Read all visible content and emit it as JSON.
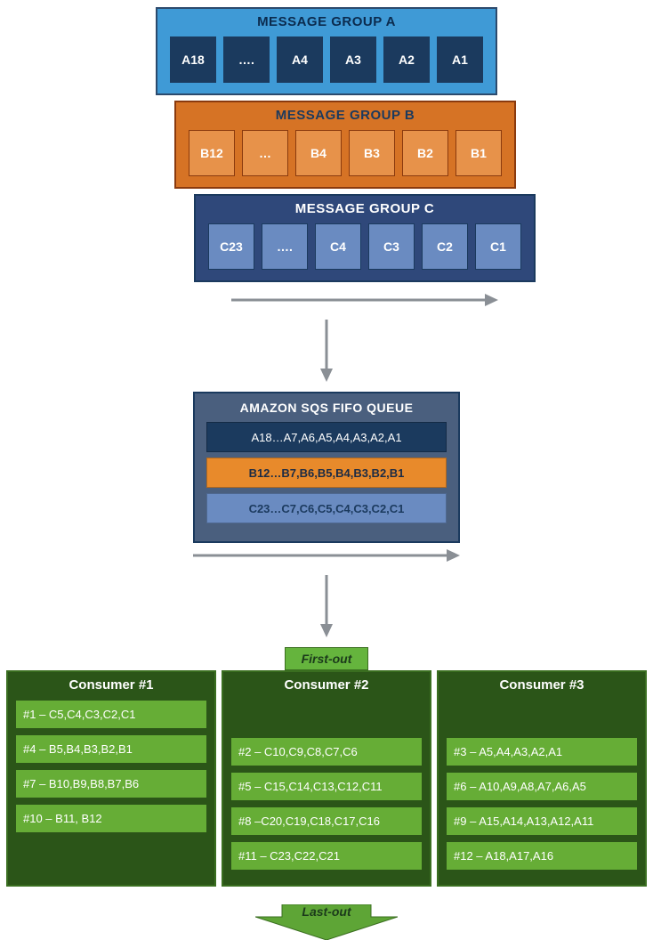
{
  "groupA": {
    "title": "MESSAGE GROUP A",
    "cells": [
      "A18",
      "….",
      "A4",
      "A3",
      "A2",
      "A1"
    ]
  },
  "groupB": {
    "title": "MESSAGE GROUP B",
    "cells": [
      "B12",
      "…",
      "B4",
      "B3",
      "B2",
      "B1"
    ]
  },
  "groupC": {
    "title": "MESSAGE GROUP C",
    "cells": [
      "C23",
      "….",
      "C4",
      "C3",
      "C2",
      "C1"
    ]
  },
  "queue": {
    "title": "AMAZON SQS FIFO QUEUE",
    "rowA": "A18…A7,A6,A5,A4,A3,A2,A1",
    "rowB": "B12…B7,B6,B5,B4,B3,B2,B1",
    "rowC": "C23…C7,C6,C5,C4,C3,C2,C1"
  },
  "labels": {
    "first_out": "First-out",
    "last_out": "Last-out"
  },
  "consumers": [
    {
      "title": "Consumer #1",
      "batches": [
        "#1 – C5,C4,C3,C2,C1",
        "#4 – B5,B4,B3,B2,B1",
        "#7 – B10,B9,B8,B7,B6",
        "#10 – B11, B12"
      ]
    },
    {
      "title": "Consumer #2",
      "batches": [
        "#2 – C10,C9,C8,C7,C6",
        "#5 – C15,C14,C13,C12,C11",
        "#8 –C20,C19,C18,C17,C16",
        "#11 – C23,C22,C21"
      ]
    },
    {
      "title": "Consumer #3",
      "batches": [
        "#3 – A5,A4,A3,A2,A1",
        "#6 – A10,A9,A8,A7,A6,A5",
        "#9 – A15,A14,A13,A12,A11",
        "#12 – A18,A17,A16"
      ]
    }
  ]
}
